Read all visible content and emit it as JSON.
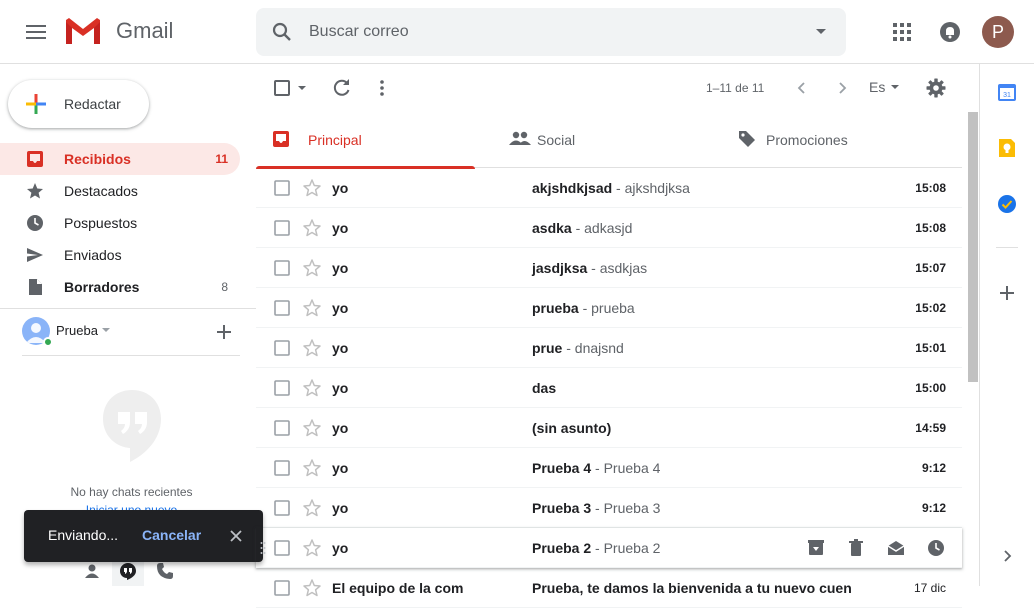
{
  "header": {
    "app_name": "Gmail",
    "search_placeholder": "Buscar correo",
    "avatar_letter": "P",
    "colors": {
      "red": "#d93025",
      "avatar": "#8d5a4e"
    }
  },
  "sidebar": {
    "compose_label": "Redactar",
    "items": [
      {
        "label": "Recibidos",
        "count": "11",
        "icon": "inbox-icon"
      },
      {
        "label": "Destacados",
        "count": "",
        "icon": "star-icon"
      },
      {
        "label": "Pospuestos",
        "count": "",
        "icon": "clock-icon"
      },
      {
        "label": "Enviados",
        "count": "",
        "icon": "send-icon"
      },
      {
        "label": "Borradores",
        "count": "8",
        "icon": "draft-icon"
      }
    ],
    "hangouts_user": "Prueba",
    "no_chats": "No hay chats recientes",
    "start_new": "Iniciar uno nuevo"
  },
  "toolbar": {
    "range": "1–11 de 11",
    "lang": "Es"
  },
  "tabs": [
    {
      "label": "Principal",
      "icon": "inbox-icon"
    },
    {
      "label": "Social",
      "icon": "people-icon"
    },
    {
      "label": "Promociones",
      "icon": "tag-icon"
    }
  ],
  "emails": [
    {
      "sender": "yo",
      "subject": "akjshdkjsad",
      "snippet": " - ajkshdjksa",
      "time": "15:08"
    },
    {
      "sender": "yo",
      "subject": "asdka",
      "snippet": " - adkasjd",
      "time": "15:08"
    },
    {
      "sender": "yo",
      "subject": "jasdjksa",
      "snippet": " - asdkjas",
      "time": "15:07"
    },
    {
      "sender": "yo",
      "subject": "prueba",
      "snippet": " - prueba",
      "time": "15:02"
    },
    {
      "sender": "yo",
      "subject": "prue",
      "snippet": " - dnajsnd",
      "time": "15:01"
    },
    {
      "sender": "yo",
      "subject": "das",
      "snippet": "",
      "time": "15:00"
    },
    {
      "sender": "yo",
      "subject": "(sin asunto)",
      "snippet": "",
      "time": "14:59"
    },
    {
      "sender": "yo",
      "subject": "Prueba 4",
      "snippet": " - Prueba 4",
      "time": "9:12"
    },
    {
      "sender": "yo",
      "subject": "Prueba 3",
      "snippet": " - Prueba 3",
      "time": "9:12"
    },
    {
      "sender": "yo",
      "subject": "Prueba 2",
      "snippet": " - Prueba 2",
      "time": ""
    },
    {
      "sender": "El equipo de la com",
      "subject": "Prueba, te damos la bienvenida a tu nuevo cuen",
      "snippet": "",
      "time": "17 dic"
    }
  ],
  "snackbar": {
    "text": "Enviando...",
    "action": "Cancelar"
  }
}
